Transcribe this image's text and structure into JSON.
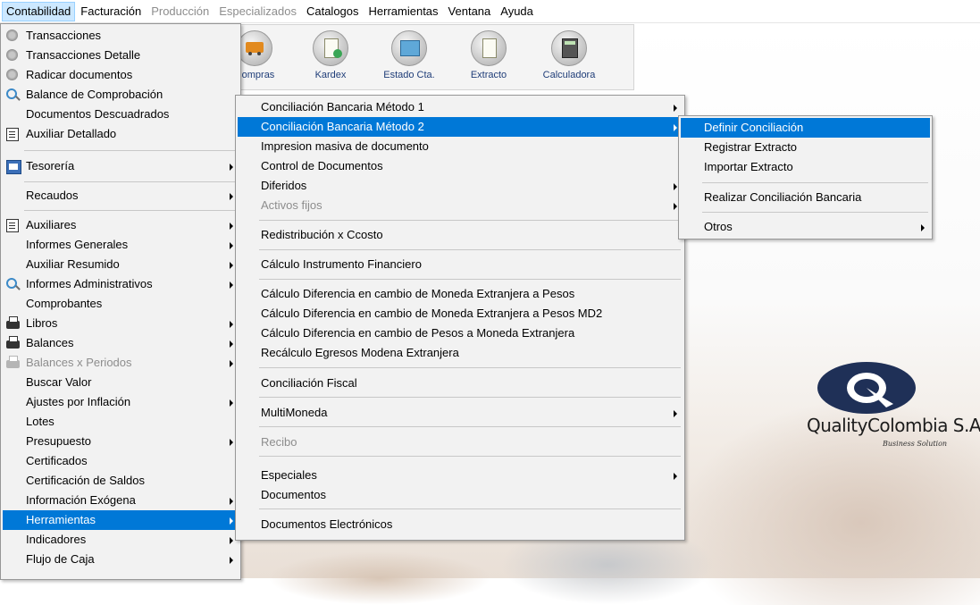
{
  "menubar": [
    {
      "label": "Contabilidad",
      "active": true
    },
    {
      "label": "Facturación"
    },
    {
      "label": "Producción",
      "disabled": true
    },
    {
      "label": "Especializados",
      "disabled": true
    },
    {
      "label": "Catalogos"
    },
    {
      "label": "Herramientas"
    },
    {
      "label": "Ventana"
    },
    {
      "label": "Ayuda"
    }
  ],
  "toolbar": [
    {
      "label": "Compras",
      "icon": "truck-icon"
    },
    {
      "label": "Kardex",
      "icon": "document-add-icon"
    },
    {
      "label": "Estado Cta.",
      "icon": "account-card-icon"
    },
    {
      "label": "Extracto",
      "icon": "statement-icon"
    },
    {
      "label": "Calculadora",
      "icon": "calculator-icon"
    }
  ],
  "menu_contabilidad": {
    "items": [
      {
        "label": "Transacciones",
        "icon": "gear-icon"
      },
      {
        "label": "Transacciones Detalle",
        "icon": "gear-icon"
      },
      {
        "label": "Radicar documentos",
        "icon": "gear-icon"
      },
      {
        "label": "Balance de Comprobación",
        "icon": "magnifier-icon"
      },
      {
        "label": "Documentos Descuadrados"
      },
      {
        "label": "Auxiliar Detallado",
        "icon": "document-icon"
      },
      {
        "label": "Tesorería",
        "icon": "treasury-icon",
        "submenu": true
      },
      {
        "label": "Recaudos",
        "submenu": true
      },
      {
        "label": "Auxiliares",
        "icon": "document-icon",
        "submenu": true
      },
      {
        "label": "Informes Generales",
        "submenu": true
      },
      {
        "label": "Auxiliar Resumido",
        "submenu": true
      },
      {
        "label": "Informes Administrativos",
        "icon": "magnifier-icon",
        "submenu": true
      },
      {
        "label": "Comprobantes"
      },
      {
        "label": "Libros",
        "icon": "printer-icon",
        "submenu": true
      },
      {
        "label": "Balances",
        "icon": "printer-icon",
        "submenu": true
      },
      {
        "label": "Balances x Periodos",
        "icon": "printer-icon",
        "submenu": true,
        "disabled": true
      },
      {
        "label": "Buscar Valor"
      },
      {
        "label": "Ajustes por Inflación",
        "submenu": true
      },
      {
        "label": "Lotes"
      },
      {
        "label": "Presupuesto",
        "submenu": true
      },
      {
        "label": "Certificados"
      },
      {
        "label": "Certificación de Saldos"
      },
      {
        "label": "Información Exógena",
        "submenu": true
      },
      {
        "label": "Herramientas",
        "submenu": true,
        "highlighted": true
      },
      {
        "label": "Indicadores",
        "submenu": true
      },
      {
        "label": "Flujo de Caja",
        "submenu": true
      }
    ]
  },
  "menu_herramientas": {
    "items": [
      {
        "label": "Conciliación Bancaria  Método 1",
        "submenu": true
      },
      {
        "label": "Conciliación Bancaria Método 2",
        "submenu": true,
        "highlighted": true
      },
      {
        "label": "Impresion masiva de documento"
      },
      {
        "label": "Control de Documentos"
      },
      {
        "label": "Diferidos",
        "submenu": true
      },
      {
        "label": "Activos fijos",
        "submenu": true,
        "disabled": true
      },
      {
        "label": "Redistribución x Ccosto"
      },
      {
        "label": "Cálculo Instrumento Financiero"
      },
      {
        "label": "Cálculo Diferencia en cambio de Moneda Extranjera a Pesos"
      },
      {
        "label": "Cálculo Diferencia en cambio de Moneda Extranjera a Pesos MD2"
      },
      {
        "label": "Cálculo Diferencia en cambio de Pesos a Moneda Extranjera"
      },
      {
        "label": "Recálculo Egresos Modena Extranjera"
      },
      {
        "label": "Conciliación Fiscal"
      },
      {
        "label": "MultiMoneda",
        "submenu": true
      },
      {
        "label": "Recibo",
        "disabled": true
      },
      {
        "label": "Especiales",
        "submenu": true
      },
      {
        "label": "Documentos"
      },
      {
        "label": "Documentos Electrónicos"
      }
    ]
  },
  "menu_conciliacion": {
    "items": [
      {
        "label": "Definir Conciliación",
        "highlighted": true
      },
      {
        "label": "Registrar Extracto"
      },
      {
        "label": "Importar Extracto"
      },
      {
        "label": "Realizar Conciliación Bancaria"
      },
      {
        "label": "Otros",
        "submenu": true
      }
    ]
  },
  "logo": {
    "name": "QualityColombia S.A.",
    "tagline": "Business Solution"
  },
  "colors": {
    "highlight": "#0078d7",
    "menu_bg": "#f2f2f2",
    "menubar_active": "#cce8ff",
    "toolbar_text": "#1f3d78"
  }
}
